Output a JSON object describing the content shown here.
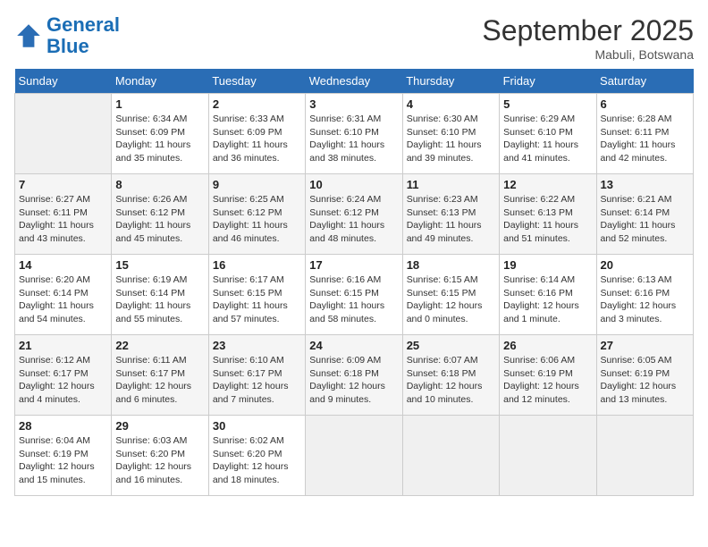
{
  "logo": {
    "line1": "General",
    "line2": "Blue"
  },
  "title": "September 2025",
  "location": "Mabuli, Botswana",
  "days_of_week": [
    "Sunday",
    "Monday",
    "Tuesday",
    "Wednesday",
    "Thursday",
    "Friday",
    "Saturday"
  ],
  "weeks": [
    [
      {
        "day": "",
        "empty": true
      },
      {
        "day": "1",
        "sunrise": "Sunrise: 6:34 AM",
        "sunset": "Sunset: 6:09 PM",
        "daylight": "Daylight: 11 hours and 35 minutes."
      },
      {
        "day": "2",
        "sunrise": "Sunrise: 6:33 AM",
        "sunset": "Sunset: 6:09 PM",
        "daylight": "Daylight: 11 hours and 36 minutes."
      },
      {
        "day": "3",
        "sunrise": "Sunrise: 6:31 AM",
        "sunset": "Sunset: 6:10 PM",
        "daylight": "Daylight: 11 hours and 38 minutes."
      },
      {
        "day": "4",
        "sunrise": "Sunrise: 6:30 AM",
        "sunset": "Sunset: 6:10 PM",
        "daylight": "Daylight: 11 hours and 39 minutes."
      },
      {
        "day": "5",
        "sunrise": "Sunrise: 6:29 AM",
        "sunset": "Sunset: 6:10 PM",
        "daylight": "Daylight: 11 hours and 41 minutes."
      },
      {
        "day": "6",
        "sunrise": "Sunrise: 6:28 AM",
        "sunset": "Sunset: 6:11 PM",
        "daylight": "Daylight: 11 hours and 42 minutes."
      }
    ],
    [
      {
        "day": "7",
        "sunrise": "Sunrise: 6:27 AM",
        "sunset": "Sunset: 6:11 PM",
        "daylight": "Daylight: 11 hours and 43 minutes."
      },
      {
        "day": "8",
        "sunrise": "Sunrise: 6:26 AM",
        "sunset": "Sunset: 6:12 PM",
        "daylight": "Daylight: 11 hours and 45 minutes."
      },
      {
        "day": "9",
        "sunrise": "Sunrise: 6:25 AM",
        "sunset": "Sunset: 6:12 PM",
        "daylight": "Daylight: 11 hours and 46 minutes."
      },
      {
        "day": "10",
        "sunrise": "Sunrise: 6:24 AM",
        "sunset": "Sunset: 6:12 PM",
        "daylight": "Daylight: 11 hours and 48 minutes."
      },
      {
        "day": "11",
        "sunrise": "Sunrise: 6:23 AM",
        "sunset": "Sunset: 6:13 PM",
        "daylight": "Daylight: 11 hours and 49 minutes."
      },
      {
        "day": "12",
        "sunrise": "Sunrise: 6:22 AM",
        "sunset": "Sunset: 6:13 PM",
        "daylight": "Daylight: 11 hours and 51 minutes."
      },
      {
        "day": "13",
        "sunrise": "Sunrise: 6:21 AM",
        "sunset": "Sunset: 6:14 PM",
        "daylight": "Daylight: 11 hours and 52 minutes."
      }
    ],
    [
      {
        "day": "14",
        "sunrise": "Sunrise: 6:20 AM",
        "sunset": "Sunset: 6:14 PM",
        "daylight": "Daylight: 11 hours and 54 minutes."
      },
      {
        "day": "15",
        "sunrise": "Sunrise: 6:19 AM",
        "sunset": "Sunset: 6:14 PM",
        "daylight": "Daylight: 11 hours and 55 minutes."
      },
      {
        "day": "16",
        "sunrise": "Sunrise: 6:17 AM",
        "sunset": "Sunset: 6:15 PM",
        "daylight": "Daylight: 11 hours and 57 minutes."
      },
      {
        "day": "17",
        "sunrise": "Sunrise: 6:16 AM",
        "sunset": "Sunset: 6:15 PM",
        "daylight": "Daylight: 11 hours and 58 minutes."
      },
      {
        "day": "18",
        "sunrise": "Sunrise: 6:15 AM",
        "sunset": "Sunset: 6:15 PM",
        "daylight": "Daylight: 12 hours and 0 minutes."
      },
      {
        "day": "19",
        "sunrise": "Sunrise: 6:14 AM",
        "sunset": "Sunset: 6:16 PM",
        "daylight": "Daylight: 12 hours and 1 minute."
      },
      {
        "day": "20",
        "sunrise": "Sunrise: 6:13 AM",
        "sunset": "Sunset: 6:16 PM",
        "daylight": "Daylight: 12 hours and 3 minutes."
      }
    ],
    [
      {
        "day": "21",
        "sunrise": "Sunrise: 6:12 AM",
        "sunset": "Sunset: 6:17 PM",
        "daylight": "Daylight: 12 hours and 4 minutes."
      },
      {
        "day": "22",
        "sunrise": "Sunrise: 6:11 AM",
        "sunset": "Sunset: 6:17 PM",
        "daylight": "Daylight: 12 hours and 6 minutes."
      },
      {
        "day": "23",
        "sunrise": "Sunrise: 6:10 AM",
        "sunset": "Sunset: 6:17 PM",
        "daylight": "Daylight: 12 hours and 7 minutes."
      },
      {
        "day": "24",
        "sunrise": "Sunrise: 6:09 AM",
        "sunset": "Sunset: 6:18 PM",
        "daylight": "Daylight: 12 hours and 9 minutes."
      },
      {
        "day": "25",
        "sunrise": "Sunrise: 6:07 AM",
        "sunset": "Sunset: 6:18 PM",
        "daylight": "Daylight: 12 hours and 10 minutes."
      },
      {
        "day": "26",
        "sunrise": "Sunrise: 6:06 AM",
        "sunset": "Sunset: 6:19 PM",
        "daylight": "Daylight: 12 hours and 12 minutes."
      },
      {
        "day": "27",
        "sunrise": "Sunrise: 6:05 AM",
        "sunset": "Sunset: 6:19 PM",
        "daylight": "Daylight: 12 hours and 13 minutes."
      }
    ],
    [
      {
        "day": "28",
        "sunrise": "Sunrise: 6:04 AM",
        "sunset": "Sunset: 6:19 PM",
        "daylight": "Daylight: 12 hours and 15 minutes."
      },
      {
        "day": "29",
        "sunrise": "Sunrise: 6:03 AM",
        "sunset": "Sunset: 6:20 PM",
        "daylight": "Daylight: 12 hours and 16 minutes."
      },
      {
        "day": "30",
        "sunrise": "Sunrise: 6:02 AM",
        "sunset": "Sunset: 6:20 PM",
        "daylight": "Daylight: 12 hours and 18 minutes."
      },
      {
        "day": "",
        "empty": true
      },
      {
        "day": "",
        "empty": true
      },
      {
        "day": "",
        "empty": true
      },
      {
        "day": "",
        "empty": true
      }
    ]
  ]
}
